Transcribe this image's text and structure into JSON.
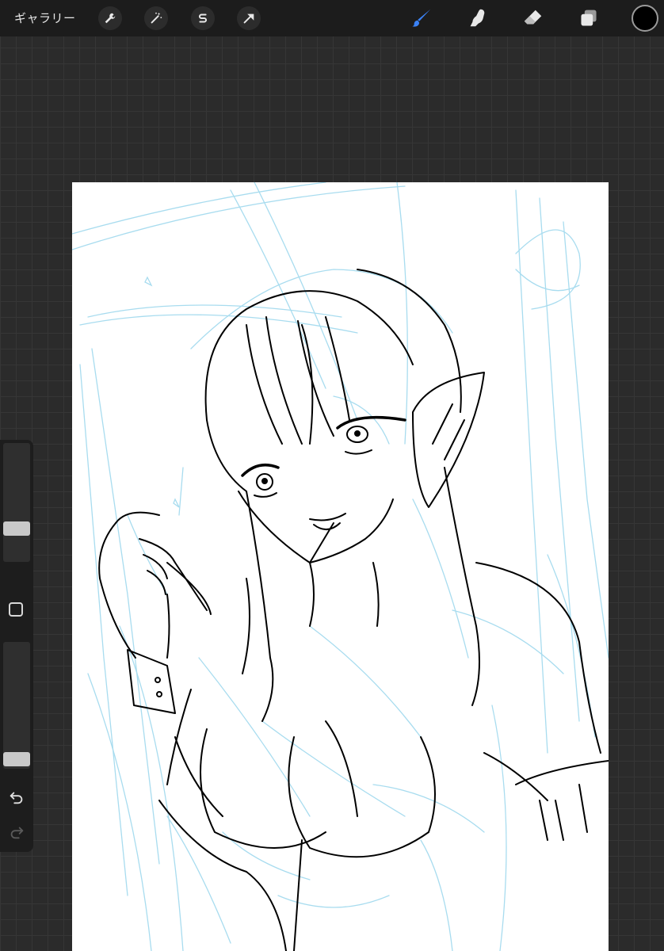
{
  "topbar": {
    "gallery_label": "ギャラリー",
    "left_tools": [
      {
        "name": "actions",
        "icon": "wrench-icon"
      },
      {
        "name": "adjustments",
        "icon": "magic-wand-icon"
      },
      {
        "name": "selection",
        "icon": "selection-s-icon"
      },
      {
        "name": "transform",
        "icon": "arrow-cursor-icon"
      }
    ],
    "right_tools": [
      {
        "name": "brush",
        "icon": "brush-icon",
        "active": true
      },
      {
        "name": "smudge",
        "icon": "smudge-finger-icon"
      },
      {
        "name": "eraser",
        "icon": "eraser-icon"
      },
      {
        "name": "layers",
        "icon": "layers-icon"
      }
    ],
    "current_color": "#000000",
    "accent_color": "#3b82f6"
  },
  "sidebar": {
    "brush_size_level": 0.25,
    "opacity_level": 0.02,
    "modify_icon": "square-icon",
    "undo_icon": "undo-arrow-icon",
    "redo_icon": "redo-arrow-icon"
  },
  "canvas": {
    "background": "#ffffff",
    "sketch_color": "#a8dcef",
    "lineart_color": "#000000"
  }
}
